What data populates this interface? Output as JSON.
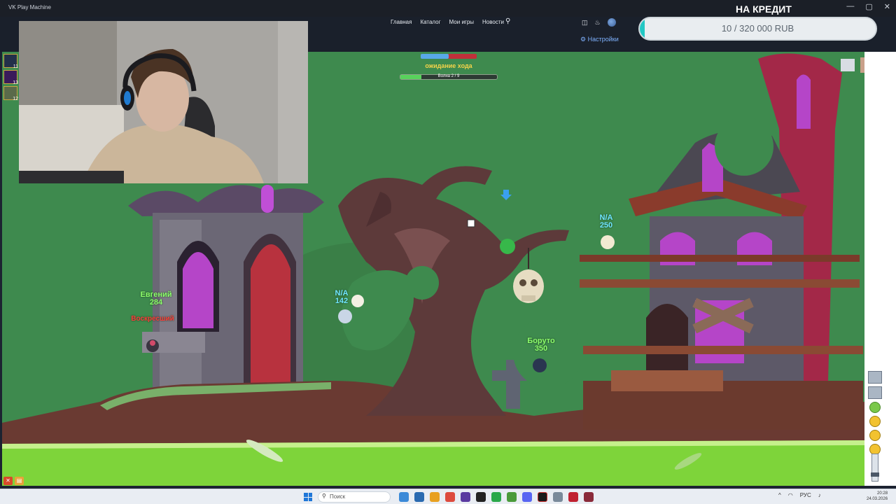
{
  "window": {
    "title": "VK Play Machine",
    "controls": [
      "—",
      "▢",
      "✕"
    ]
  },
  "nav": {
    "links": [
      "Главная",
      "Каталог",
      "Мои игры",
      "Новости"
    ],
    "search_icon": "search-icon",
    "settings_label": "Настройки"
  },
  "credit": {
    "title": "НА КРЕДИТ",
    "progress_text": "10 / 320 000 RUB",
    "current": 10,
    "goal": 320000
  },
  "left_slots": [
    {
      "count": "11"
    },
    {
      "count": "13"
    },
    {
      "count": "12"
    }
  ],
  "hud": {
    "player_hp_fraction": 0.5,
    "turn_status": "ожидание хода",
    "wave_text": "Волна 2 / 9",
    "wave_fraction": 0.22
  },
  "units": [
    {
      "name": "Евгений",
      "hp": "284",
      "color": "green"
    },
    {
      "name": "Воскресший",
      "hp": "",
      "color": "red"
    },
    {
      "name": "N/A",
      "hp": "142",
      "color": "cyan"
    },
    {
      "name": "N/A",
      "hp": "250",
      "color": "cyan"
    },
    {
      "name": "Боруто",
      "hp": "350",
      "color": "green"
    }
  ],
  "taskbar": {
    "search_placeholder": "Поиск",
    "language": "РУС",
    "time": "20:28",
    "date": "24.03.2026"
  },
  "colors": {
    "accent": "#22c7c4",
    "sky": "#3e8a4e",
    "acid": "#7ed43a"
  }
}
